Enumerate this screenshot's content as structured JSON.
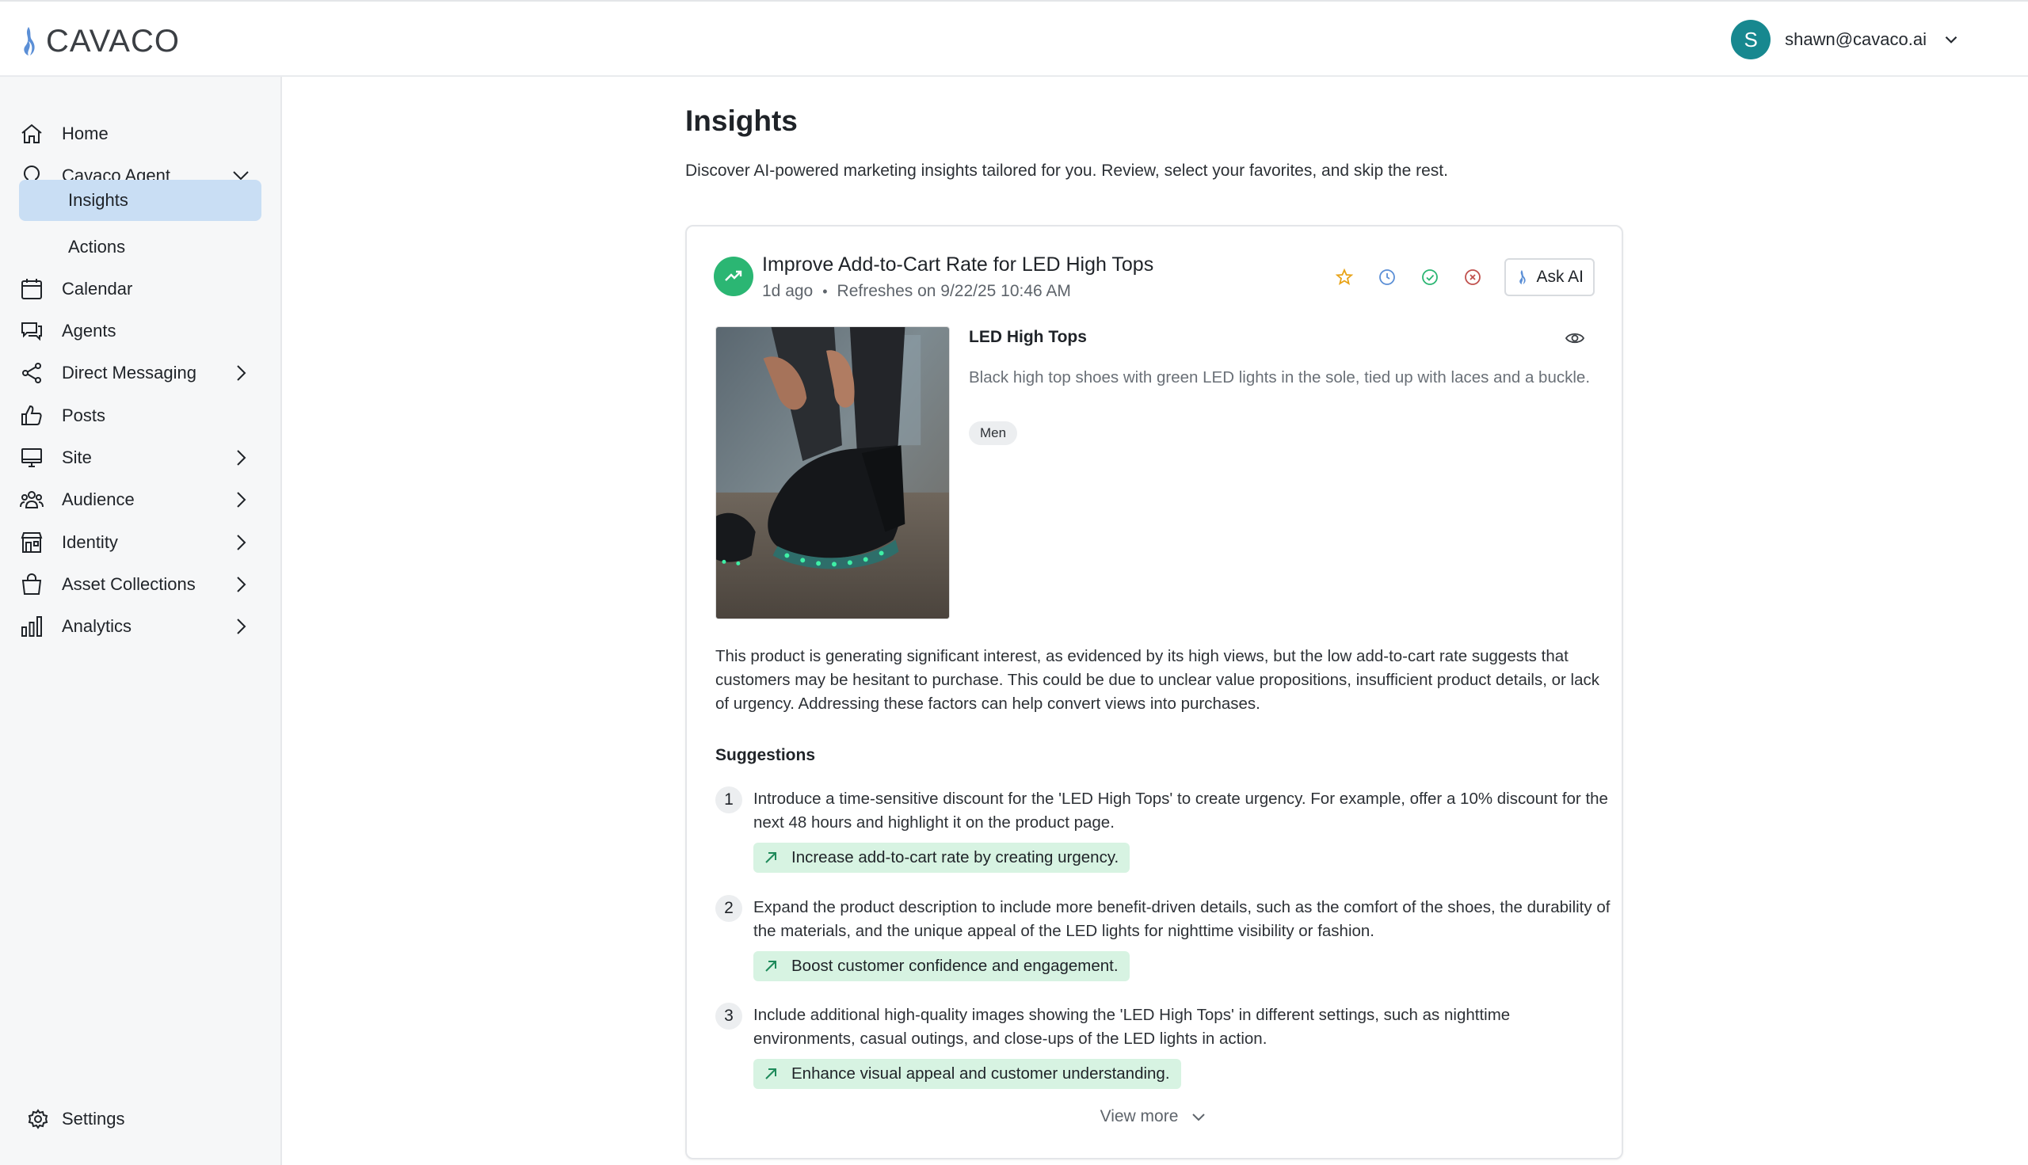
{
  "brand": {
    "name": "CAVACO"
  },
  "user": {
    "initial": "S",
    "email": "shawn@cavaco.ai"
  },
  "sidebar": {
    "items": [
      {
        "label": "Home",
        "icon": "home-icon"
      },
      {
        "label": "Cavaco Agent",
        "icon": "lightbulb-icon",
        "expanded": true
      },
      {
        "label": "Insights",
        "active": true
      },
      {
        "label": "Actions"
      },
      {
        "label": "Calendar",
        "icon": "calendar-icon"
      },
      {
        "label": "Agents",
        "icon": "chat-icon"
      },
      {
        "label": "Direct Messaging",
        "icon": "share-icon"
      },
      {
        "label": "Posts",
        "icon": "thumbs-up-icon"
      },
      {
        "label": "Site",
        "icon": "monitor-icon"
      },
      {
        "label": "Audience",
        "icon": "users-icon"
      },
      {
        "label": "Identity",
        "icon": "building-icon"
      },
      {
        "label": "Asset Collections",
        "icon": "bag-icon"
      },
      {
        "label": "Analytics",
        "icon": "bar-chart-icon"
      }
    ],
    "settings_label": "Settings"
  },
  "page": {
    "title": "Insights",
    "subtitle": "Discover AI-powered marketing insights tailored for you. Review, select your favorites, and skip the rest."
  },
  "insight": {
    "title": "Improve Add-to-Cart Rate for LED High Tops",
    "age": "1d ago",
    "refresh": "Refreshes on 9/22/25 10:46 AM",
    "ask_ai_label": "Ask AI",
    "product": {
      "name": "LED High Tops",
      "description": "Black high top shoes with green LED lights in the sole, tied up with laces and a buckle.",
      "tag": "Men"
    },
    "analysis": "This product is generating significant interest, as evidenced by its high views, but the low add-to-cart rate suggests that customers may be hesitant to purchase. This could be due to unclear value propositions, insufficient product details, or lack of urgency. Addressing these factors can help convert views into purchases.",
    "suggestions_heading": "Suggestions",
    "suggestions": [
      {
        "num": "1",
        "text": "Introduce a time-sensitive discount for the 'LED High Tops' to create urgency. For example, offer a 10% discount for the next 48 hours and highlight it on the product page.",
        "impact": "Increase add-to-cart rate by creating urgency."
      },
      {
        "num": "2",
        "text": "Expand the product description to include more benefit-driven details, such as the comfort of the shoes, the durability of the materials, and the unique appeal of the LED lights for nighttime visibility or fashion.",
        "impact": "Boost customer confidence and engagement."
      },
      {
        "num": "3",
        "text": "Include additional high-quality images showing the 'LED High Tops' in different settings, such as nighttime environments, casual outings, and close-ups of the LED lights in action.",
        "impact": "Enhance visual appeal and customer understanding."
      }
    ],
    "view_more_label": "View more"
  },
  "colors": {
    "accent": "#17888f",
    "active_nav": "#c9def4",
    "trend_green": "#2bb673",
    "impact_bg": "#d7f3e2",
    "star": "#e8a317"
  }
}
